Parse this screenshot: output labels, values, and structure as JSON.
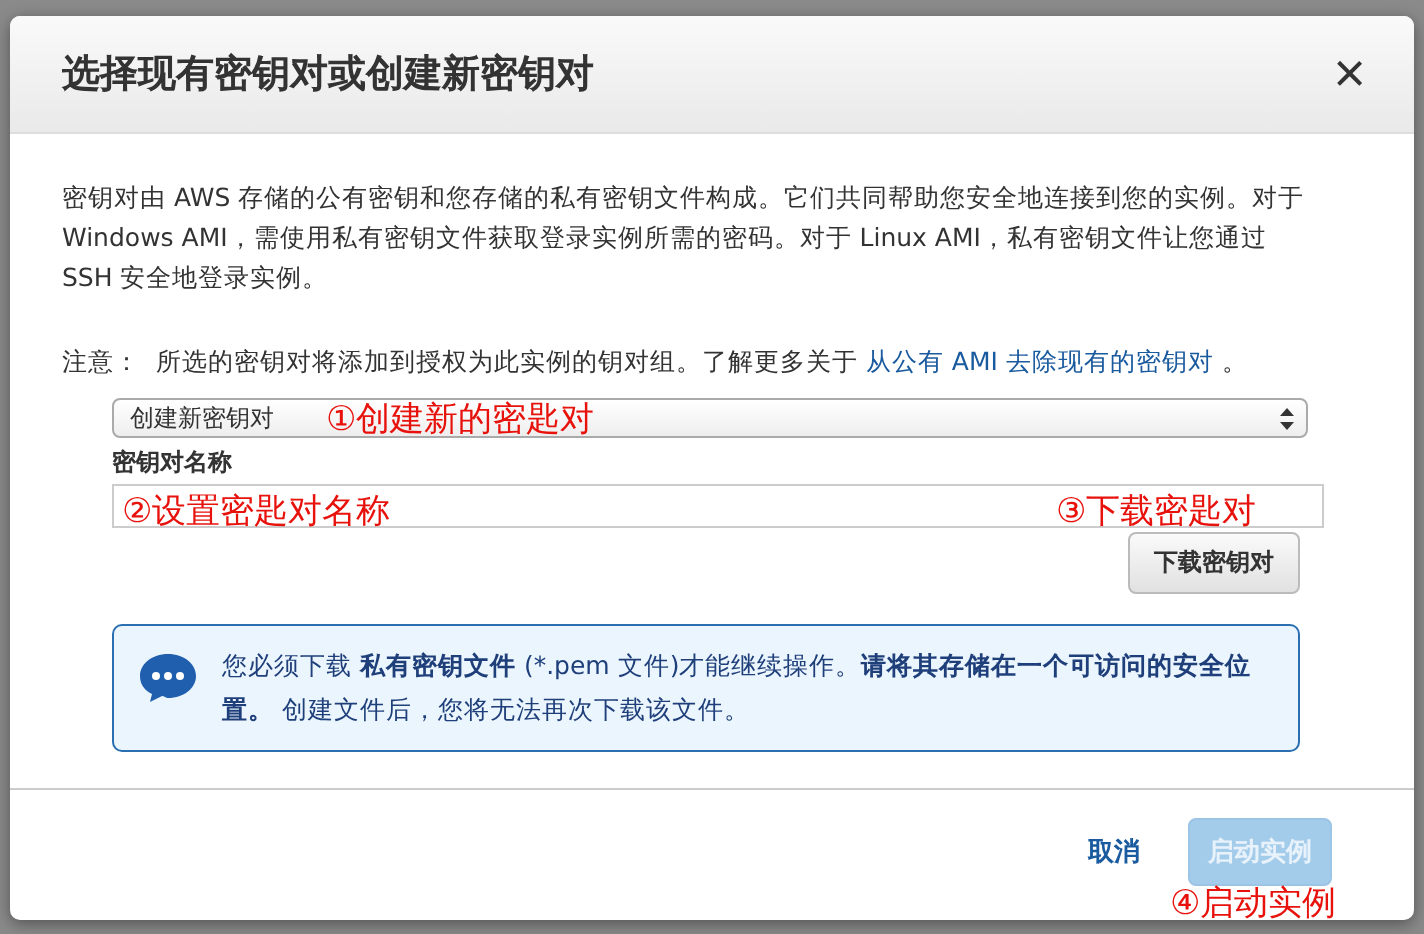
{
  "dialog": {
    "title": "选择现有密钥对或创建新密钥对",
    "close": "×"
  },
  "description": "密钥对由 AWS 存储的公有密钥和您存储的私有密钥文件构成。它们共同帮助您安全地连接到您的实例。对于 Windows AMI，需使用私有密钥文件获取登录实例所需的密码。对于 Linux AMI，私有密钥文件让您通过 SSH 安全地登录实例。",
  "note": {
    "label": "注意：",
    "text": "所选的密钥对将添加到授权为此实例的钥对组。了解更多关于",
    "link": "从公有 AMI 去除现有的密钥对",
    "end": "。"
  },
  "key_pair_select": {
    "value": "创建新密钥对"
  },
  "key_pair_name": {
    "label": "密钥对名称"
  },
  "download_button": {
    "label": "下载密钥对"
  },
  "info": {
    "text": "您必须下载 **私有密钥文件** (*.pem 文件)才能继续操作。**请将其存储在一个可访问的安全位置。** 创建文件后，您将无法再次下载该文件。"
  },
  "buttons": [
    {
      "label": "取消",
      "kind": "link",
      "disabled": false
    },
    {
      "label": "启动实例",
      "kind": "primary",
      "disabled": true
    }
  ],
  "annotations": [
    {
      "text": "①创建新的密匙对"
    },
    {
      "text": "②设置密匙对名称"
    },
    {
      "text": "③下载密匙对"
    },
    {
      "text": "④启动实例"
    }
  ]
}
